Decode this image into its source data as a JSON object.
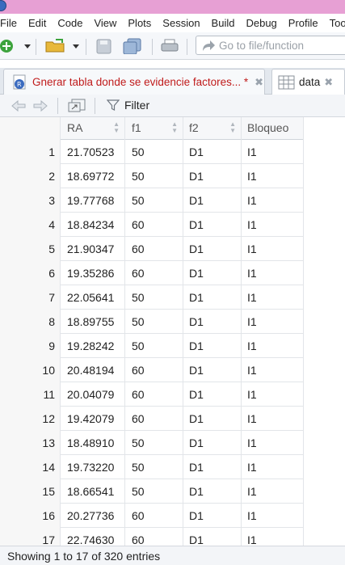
{
  "menubar": {
    "items": [
      "File",
      "Edit",
      "Code",
      "View",
      "Plots",
      "Session",
      "Build",
      "Debug",
      "Profile",
      "Tools"
    ]
  },
  "toolbar": {
    "goto_placeholder": "Go to file/function"
  },
  "tabs": [
    {
      "title": "Gnerar tabla donde se evidencie factores... *",
      "icon": "r-script-icon",
      "active": false
    },
    {
      "title": "data",
      "icon": "table-icon",
      "active": true
    }
  ],
  "viewer": {
    "filter_label": "Filter"
  },
  "table": {
    "columns": [
      "RA",
      "f1",
      "f2",
      "Bloqueo"
    ],
    "rows": [
      {
        "idx": "1",
        "RA": "21.70523",
        "f1": "50",
        "f2": "D1",
        "Bloqueo": "I1"
      },
      {
        "idx": "2",
        "RA": "18.69772",
        "f1": "50",
        "f2": "D1",
        "Bloqueo": "I1"
      },
      {
        "idx": "3",
        "RA": "19.77768",
        "f1": "50",
        "f2": "D1",
        "Bloqueo": "I1"
      },
      {
        "idx": "4",
        "RA": "18.84234",
        "f1": "60",
        "f2": "D1",
        "Bloqueo": "I1"
      },
      {
        "idx": "5",
        "RA": "21.90347",
        "f1": "60",
        "f2": "D1",
        "Bloqueo": "I1"
      },
      {
        "idx": "6",
        "RA": "19.35286",
        "f1": "60",
        "f2": "D1",
        "Bloqueo": "I1"
      },
      {
        "idx": "7",
        "RA": "22.05641",
        "f1": "50",
        "f2": "D1",
        "Bloqueo": "I1"
      },
      {
        "idx": "8",
        "RA": "18.89755",
        "f1": "50",
        "f2": "D1",
        "Bloqueo": "I1"
      },
      {
        "idx": "9",
        "RA": "19.28242",
        "f1": "50",
        "f2": "D1",
        "Bloqueo": "I1"
      },
      {
        "idx": "10",
        "RA": "20.48194",
        "f1": "60",
        "f2": "D1",
        "Bloqueo": "I1"
      },
      {
        "idx": "11",
        "RA": "20.04079",
        "f1": "60",
        "f2": "D1",
        "Bloqueo": "I1"
      },
      {
        "idx": "12",
        "RA": "19.42079",
        "f1": "60",
        "f2": "D1",
        "Bloqueo": "I1"
      },
      {
        "idx": "13",
        "RA": "18.48910",
        "f1": "50",
        "f2": "D1",
        "Bloqueo": "I1"
      },
      {
        "idx": "14",
        "RA": "19.73220",
        "f1": "50",
        "f2": "D1",
        "Bloqueo": "I1"
      },
      {
        "idx": "15",
        "RA": "18.66541",
        "f1": "50",
        "f2": "D1",
        "Bloqueo": "I1"
      },
      {
        "idx": "16",
        "RA": "20.27736",
        "f1": "60",
        "f2": "D1",
        "Bloqueo": "I1"
      },
      {
        "idx": "17",
        "RA": "22.74630",
        "f1": "60",
        "f2": "D1",
        "Bloqueo": "I1"
      }
    ]
  },
  "status": {
    "text": "Showing 1 to 17 of 320 entries"
  },
  "colors": {
    "title_bar": "#e7a0d4",
    "modified_tab_text": "#c01b1b",
    "toolbar_bg": "#f5f7fa"
  }
}
